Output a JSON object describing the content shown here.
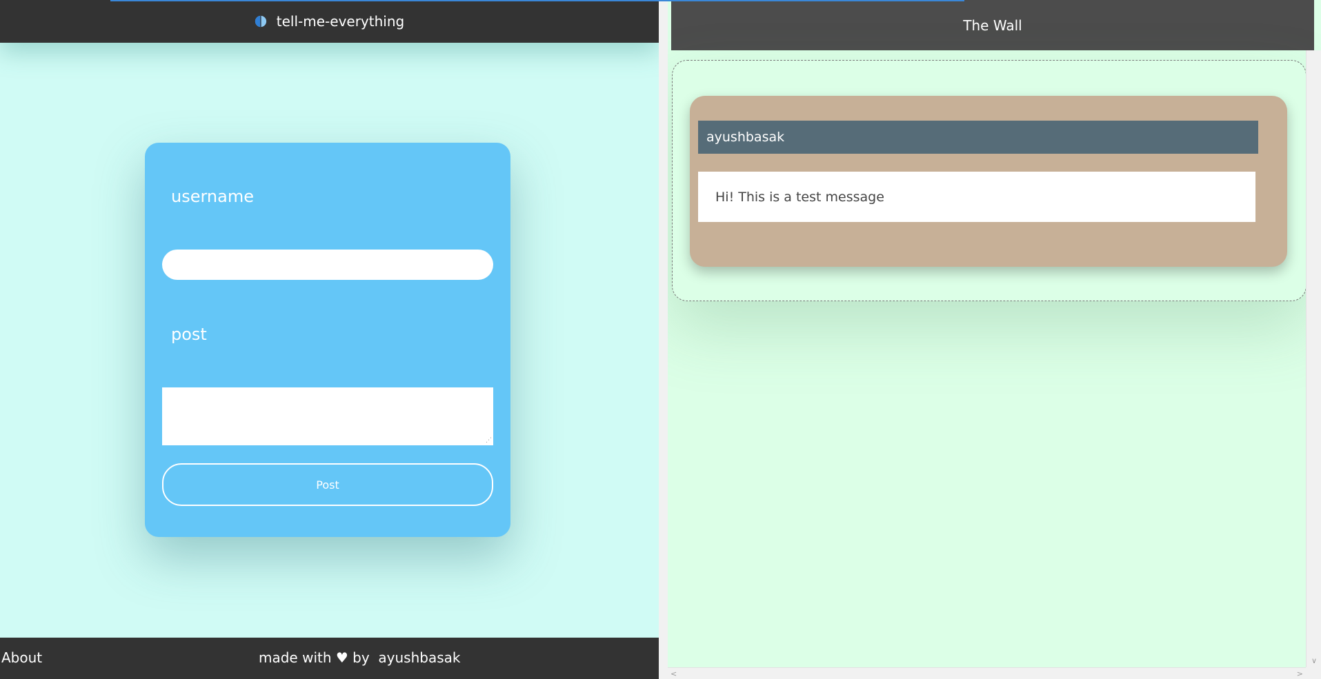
{
  "left": {
    "brand": {
      "title": "tell-me-everything",
      "logo_icon": "half-circle-logo-icon",
      "logo_color": "#3a87d8"
    },
    "form": {
      "username_label": "username",
      "username_value": "",
      "post_label": "post",
      "post_value": "",
      "submit_label": "Post"
    },
    "footer": {
      "about_label": "About",
      "credits": "made with ♥ by  ayushbasak"
    }
  },
  "right": {
    "header_title": "The Wall",
    "posts": [
      {
        "author": "ayushbasak",
        "message": "Hi! This is a test message"
      }
    ]
  },
  "colors": {
    "left_background": "#d0fbf5",
    "card": "#64c6f7",
    "header": "#333333",
    "right_background": "#dcffe7",
    "post_card": "#c7b097",
    "post_author_bar": "#566c78"
  }
}
